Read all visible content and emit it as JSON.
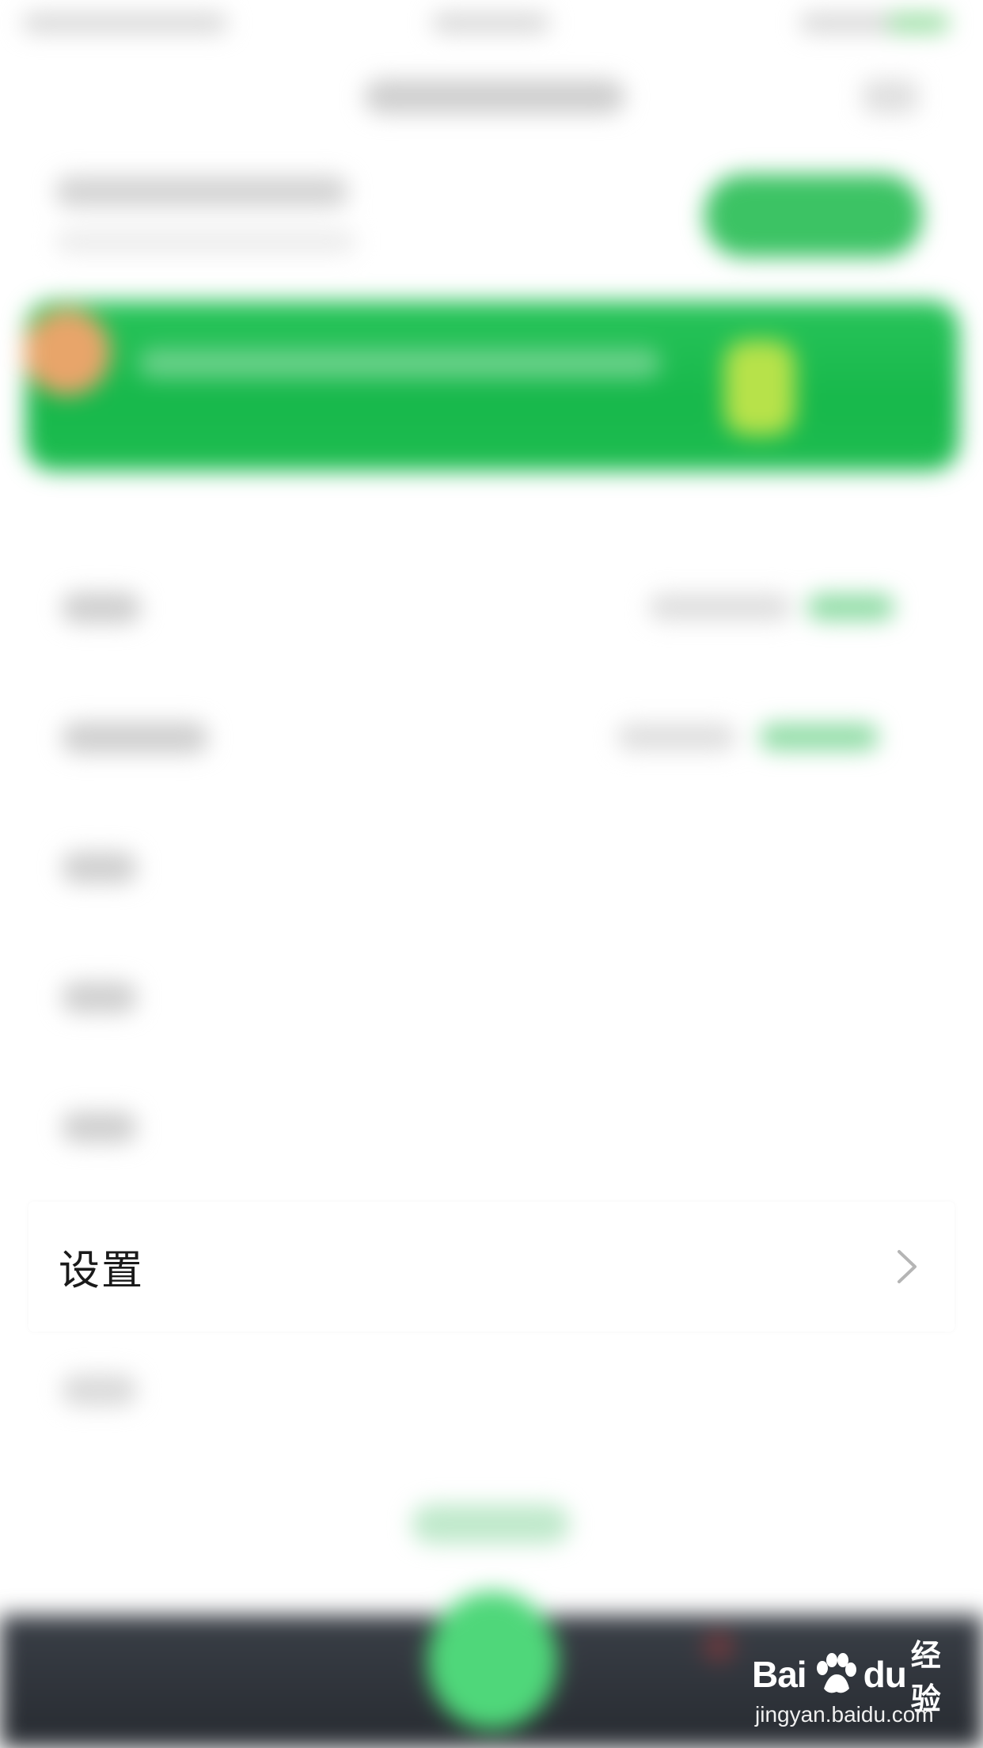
{
  "settings_row": {
    "label": "设置",
    "chevron_icon": "chevron-right-icon"
  },
  "watermark": {
    "brand": "Bai",
    "paw_icon": "baidu-paw-icon",
    "brand_suffix": "du",
    "cn_text": "经验",
    "url": "jingyan.baidu.com"
  },
  "colors": {
    "accent_green": "#1fbd51",
    "tab_bar_dark": "#2e3239",
    "text_primary": "#1a1a1a",
    "chevron_gray": "#b5b5b5"
  }
}
